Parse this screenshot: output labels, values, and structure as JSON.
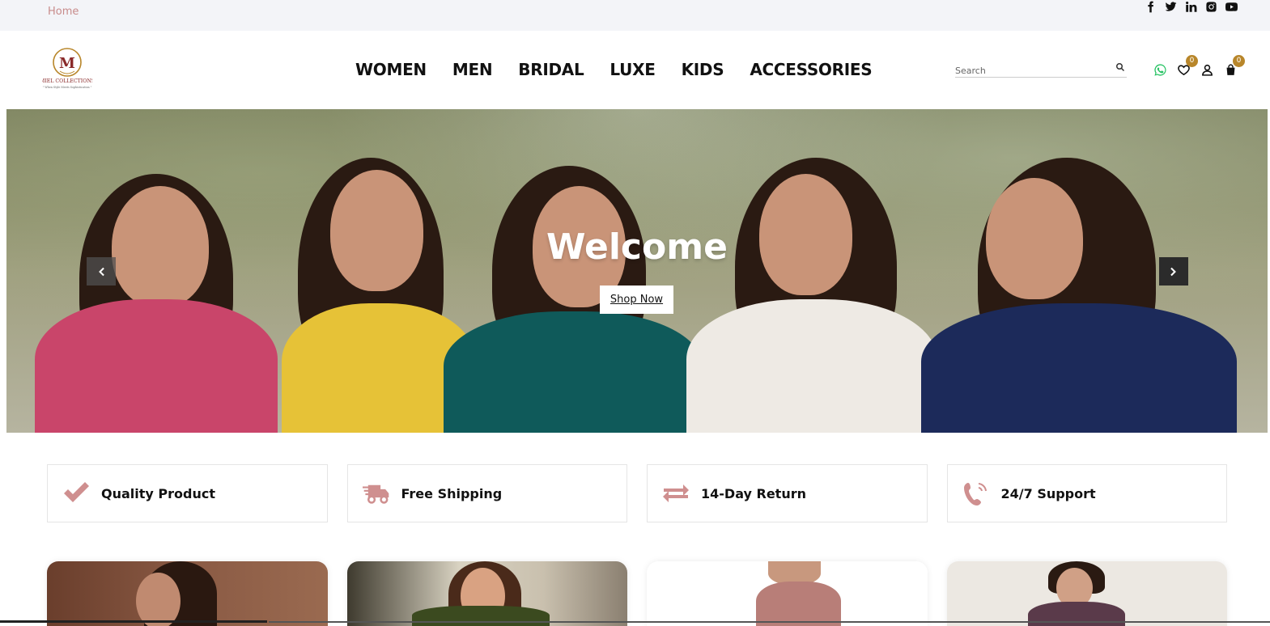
{
  "topbar": {
    "home_label": "Home",
    "social": [
      "facebook-icon",
      "twitter-icon",
      "linkedin-icon",
      "instagram-icon",
      "youtube-icon"
    ]
  },
  "header": {
    "logo_text": "MIEL COLLECTIONS",
    "logo_tagline": "When Style Meets Sophistication",
    "nav": [
      "WOMEN",
      "MEN",
      "BRIDAL",
      "LUXE",
      "KIDS",
      "ACCESSORIES"
    ],
    "search_placeholder": "Search",
    "wishlist_count": "0",
    "cart_count": "0"
  },
  "hero": {
    "title": "Welcome",
    "cta_label": "Shop Now"
  },
  "features": [
    {
      "label": "Quality Product",
      "icon": "check-icon"
    },
    {
      "label": "Free Shipping",
      "icon": "truck-icon"
    },
    {
      "label": "14-Day Return",
      "icon": "exchange-icon"
    },
    {
      "label": "24/7 Support",
      "icon": "phone-icon"
    }
  ],
  "colors": {
    "accent": "#cf8f8f",
    "badge": "#b8862a",
    "topbar_bg": "#f3f4f8"
  }
}
